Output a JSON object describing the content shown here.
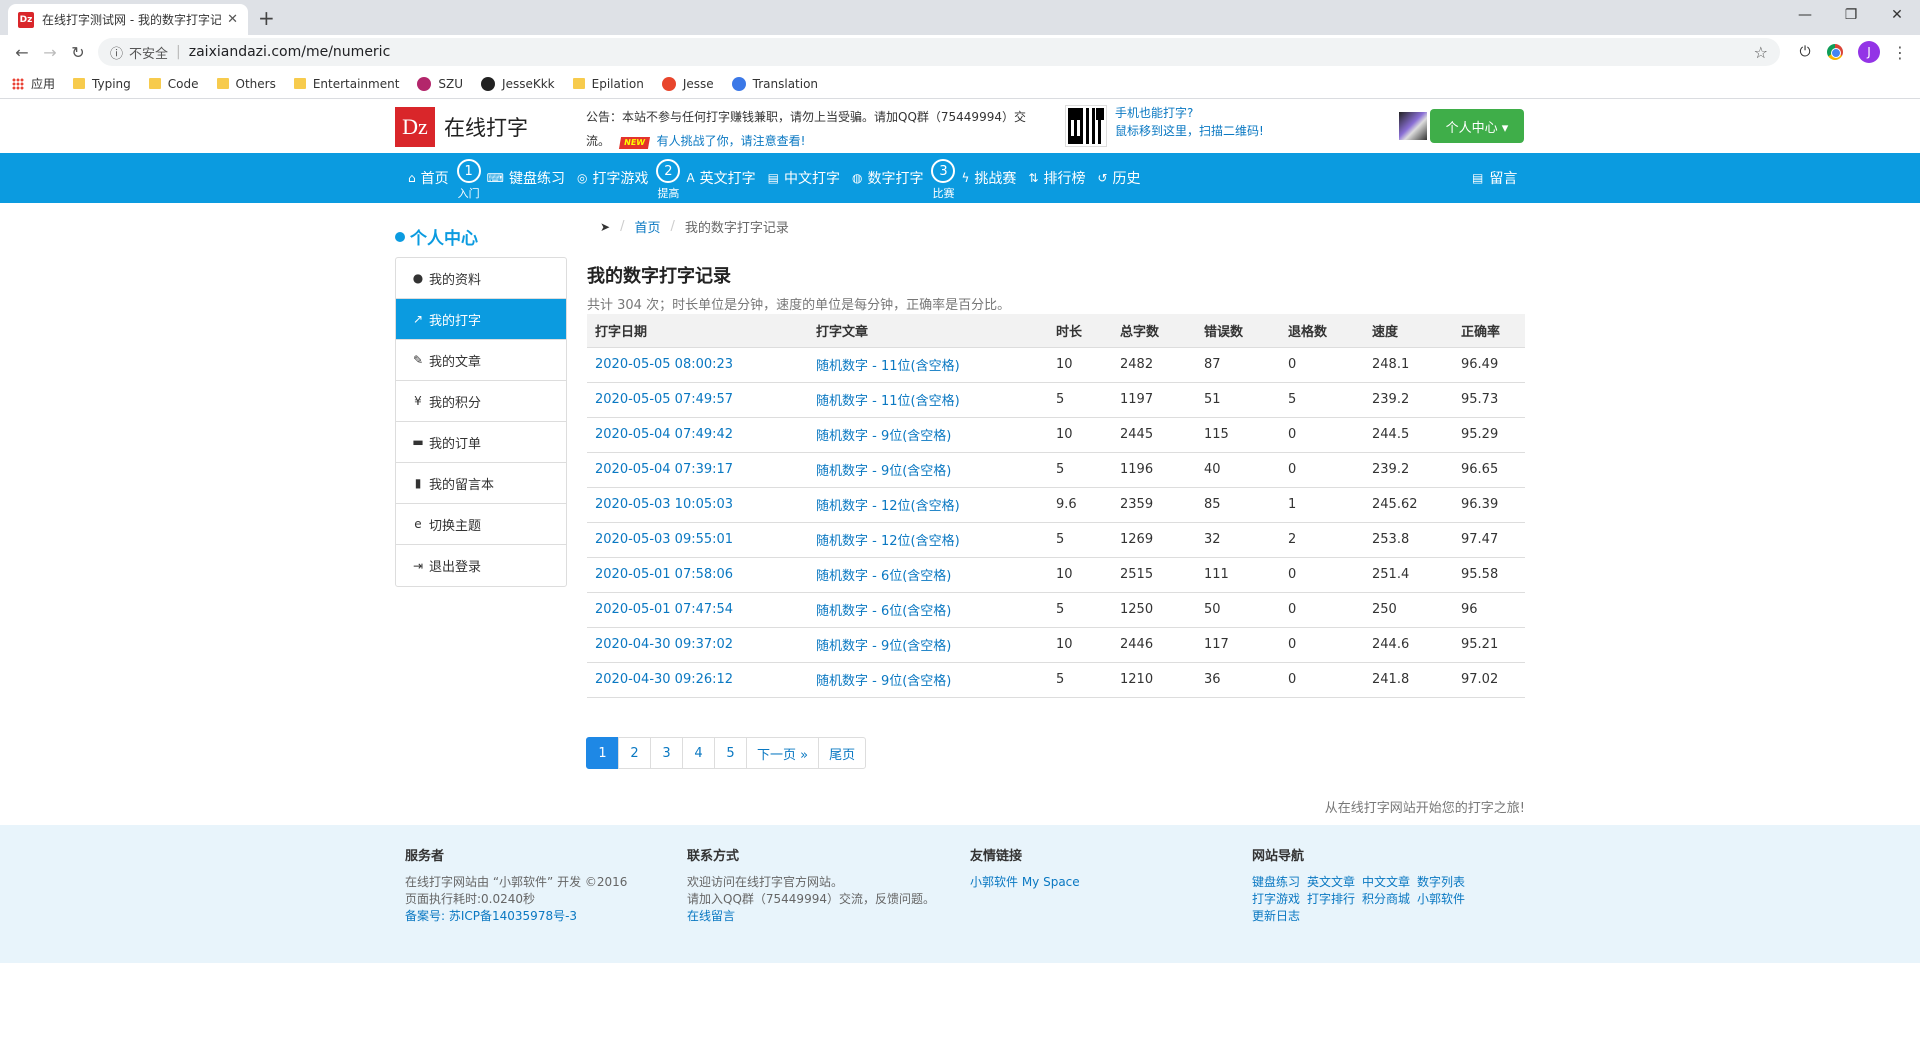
{
  "browser": {
    "tab_title": "在线打字测试网 - 我的数字打字记",
    "favicon_text": "Dz",
    "insecure_label": "不安全",
    "url": "zaixiandazi.com/me/numeric",
    "profile_initial": "J",
    "bookmarks": [
      {
        "label": "应用",
        "icon": "apps-icon"
      },
      {
        "label": "Typing",
        "icon": "folder-icon"
      },
      {
        "label": "Code",
        "icon": "folder-icon"
      },
      {
        "label": "Others",
        "icon": "folder-icon"
      },
      {
        "label": "Entertainment",
        "icon": "folder-icon"
      },
      {
        "label": "SZU",
        "icon": "szu-icon"
      },
      {
        "label": "JesseKkk",
        "icon": "github-icon"
      },
      {
        "label": "Epilation",
        "icon": "folder-icon"
      },
      {
        "label": "Jesse",
        "icon": "flame-icon"
      },
      {
        "label": "Translation",
        "icon": "translate-icon"
      }
    ]
  },
  "header": {
    "logo_mark": "Dz",
    "site_name": "在线打字",
    "notice_text": "公告：本站不参与任何打字赚钱兼职，请勿上当受骗。请加QQ群（75449994）交流。",
    "notice_badge": "NEW",
    "notice_link": "有人挑战了你，请注意查看!",
    "mobile_tip_1": "手机也能打字?",
    "mobile_tip_2": "鼠标移到这里，扫描二维码!",
    "user_center_button": "个人中心 ▾"
  },
  "nav": {
    "items": [
      {
        "label": "首页",
        "icon": "home-icon",
        "glyph": "⌂"
      },
      {
        "step": "1",
        "caption": "入门"
      },
      {
        "label": "键盘练习",
        "icon": "keyboard-icon",
        "glyph": "⌨"
      },
      {
        "label": "打字游戏",
        "icon": "gamepad-icon",
        "glyph": "◎"
      },
      {
        "step": "2",
        "caption": "提高"
      },
      {
        "label": "英文打字",
        "icon": "font-icon",
        "glyph": "A"
      },
      {
        "label": "中文打字",
        "icon": "file-icon",
        "glyph": "▤"
      },
      {
        "label": "数字打字",
        "icon": "globe-icon",
        "glyph": "◍"
      },
      {
        "step": "3",
        "caption": "比赛"
      },
      {
        "label": "挑战赛",
        "icon": "bolt-icon",
        "glyph": "ϟ"
      },
      {
        "label": "排行榜",
        "icon": "sort-icon",
        "glyph": "⇅"
      },
      {
        "label": "历史",
        "icon": "history-icon",
        "glyph": "↺"
      }
    ],
    "message_label": "留言"
  },
  "sidebar": {
    "title": "个人中心",
    "items": [
      {
        "label": "我的资料",
        "icon": "user-icon",
        "glyph": "●"
      },
      {
        "label": "我的打字",
        "icon": "line-chart-icon",
        "glyph": "↗",
        "active": true
      },
      {
        "label": "我的文章",
        "icon": "edit-icon",
        "glyph": "✎"
      },
      {
        "label": "我的积分",
        "icon": "yen-icon",
        "glyph": "¥"
      },
      {
        "label": "我的订单",
        "icon": "cart-icon",
        "glyph": "▬"
      },
      {
        "label": "我的留言本",
        "icon": "book-icon",
        "glyph": "▮"
      },
      {
        "label": "切换主题",
        "icon": "ie-icon",
        "glyph": "e"
      },
      {
        "label": "退出登录",
        "icon": "sign-out-icon",
        "glyph": "⇥"
      }
    ]
  },
  "breadcrumb": {
    "home": "首页",
    "current": "我的数字打字记录"
  },
  "main": {
    "title": "我的数字打字记录",
    "summary": "共计 304 次；时长单位是分钟，速度的单位是每分钟，正确率是百分比。",
    "columns": [
      "打字日期",
      "打字文章",
      "时长",
      "总字数",
      "错误数",
      "退格数",
      "速度",
      "正确率"
    ],
    "rows": [
      [
        "2020-05-05 08:00:23",
        "随机数字 - 11位(含空格)",
        "10",
        "2482",
        "87",
        "0",
        "248.1",
        "96.49"
      ],
      [
        "2020-05-05 07:49:57",
        "随机数字 - 11位(含空格)",
        "5",
        "1197",
        "51",
        "5",
        "239.2",
        "95.73"
      ],
      [
        "2020-05-04 07:49:42",
        "随机数字 - 9位(含空格)",
        "10",
        "2445",
        "115",
        "0",
        "244.5",
        "95.29"
      ],
      [
        "2020-05-04 07:39:17",
        "随机数字 - 9位(含空格)",
        "5",
        "1196",
        "40",
        "0",
        "239.2",
        "96.65"
      ],
      [
        "2020-05-03 10:05:03",
        "随机数字 - 12位(含空格)",
        "9.6",
        "2359",
        "85",
        "1",
        "245.62",
        "96.39"
      ],
      [
        "2020-05-03 09:55:01",
        "随机数字 - 12位(含空格)",
        "5",
        "1269",
        "32",
        "2",
        "253.8",
        "97.47"
      ],
      [
        "2020-05-01 07:58:06",
        "随机数字 - 6位(含空格)",
        "10",
        "2515",
        "111",
        "0",
        "251.4",
        "95.58"
      ],
      [
        "2020-05-01 07:47:54",
        "随机数字 - 6位(含空格)",
        "5",
        "1250",
        "50",
        "0",
        "250",
        "96"
      ],
      [
        "2020-04-30 09:37:02",
        "随机数字 - 9位(含空格)",
        "10",
        "2446",
        "117",
        "0",
        "244.6",
        "95.21"
      ],
      [
        "2020-04-30 09:26:12",
        "随机数字 - 9位(含空格)",
        "5",
        "1210",
        "36",
        "0",
        "241.8",
        "97.02"
      ]
    ],
    "pagination": [
      "1",
      "2",
      "3",
      "4",
      "5",
      "下一页 »",
      "尾页"
    ],
    "current_page": "1",
    "slogan": "从在线打字网站开始您的打字之旅!"
  },
  "footer": {
    "service": {
      "title": "服务者",
      "line1": "在线打字网站由 “小郭软件” 开发 ©2016",
      "line2": "页面执行耗时:0.0240秒",
      "icp": "备案号: 苏ICP备14035978号-3"
    },
    "contact": {
      "title": "联系方式",
      "line1": "欢迎访问在线打字官方网站。",
      "line2": "请加入QQ群（75449994）交流，反馈问题。",
      "link": "在线留言"
    },
    "friends": {
      "title": "友情链接",
      "link": "小郭软件 My Space"
    },
    "sitenav": {
      "title": "网站导航",
      "links": [
        "键盘练习",
        "英文文章",
        "中文文章",
        "数字列表",
        "打字游戏",
        "打字排行",
        "积分商城",
        "小郭软件",
        "更新日志"
      ]
    }
  }
}
